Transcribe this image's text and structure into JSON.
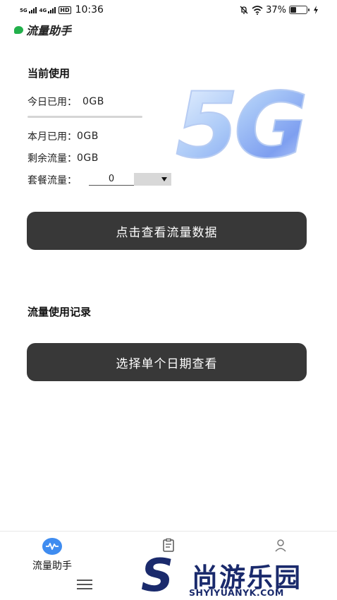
{
  "status_bar": {
    "sim1": "5G",
    "sim2": "4G",
    "hd_badge": "HD",
    "time": "10:36",
    "battery_percent": "37%",
    "battery_level": 0.37,
    "icons": [
      "mute-icon",
      "wifi-icon",
      "battery-icon",
      "charging-icon"
    ]
  },
  "app": {
    "title": "流量助手",
    "logo_color": "#22b04b"
  },
  "usage": {
    "section_title": "当前使用",
    "today_label": "今日已用：",
    "today_value": "0GB",
    "today_progress": 0,
    "month_label": "本月已用：",
    "month_value": "0GB",
    "remaining_label": "剩余流量：",
    "remaining_value": "0GB",
    "package_label": "套餐流量：",
    "package_value": "0",
    "graphic_text": "5G"
  },
  "actions": {
    "view_data_button": "点击查看流量数据",
    "history_title": "流量使用记录",
    "select_date_button": "选择单个日期查看"
  },
  "bottom_nav": {
    "items": [
      {
        "label": "流量助手",
        "icon": "pulse-icon",
        "active": true
      },
      {
        "label": "",
        "icon": "clipboard-icon",
        "active": false
      },
      {
        "label": "",
        "icon": "user-icon",
        "active": false
      }
    ],
    "accent": "#3f8cf0"
  },
  "watermark": {
    "brand_cn": "尚游乐园",
    "brand_en": "SHYIYUANYK.COM",
    "brand_color": "#1a2a6c"
  },
  "colors": {
    "button_bg": "#383838",
    "button_text": "#ffffff"
  }
}
